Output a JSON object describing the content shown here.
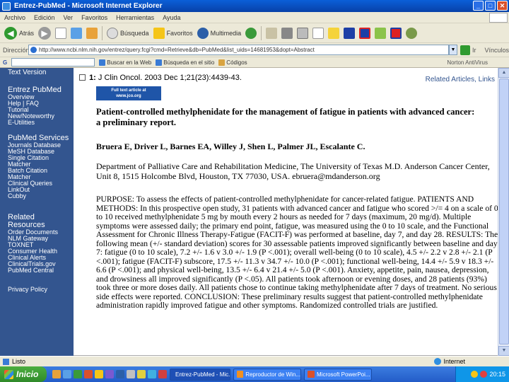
{
  "window": {
    "title": "Entrez-PubMed - Microsoft Internet Explorer",
    "minimize": "_",
    "maximize": "□",
    "close": "✕"
  },
  "menu": [
    "Archivo",
    "Edición",
    "Ver",
    "Favoritos",
    "Herramientas",
    "Ayuda"
  ],
  "toolbar": {
    "back_label": "Atrás",
    "search_label": "Búsqueda",
    "favorites_label": "Favoritos",
    "multimedia_label": "Multimedia"
  },
  "address": {
    "label": "Dirección",
    "url": "http://www.ncbi.nlm.nih.gov/entrez/query.fcgi?cmd=Retrieve&db=PubMed&list_uids=14681953&dopt=Abstract",
    "go_label": "Ir",
    "links_label": "Vínculos"
  },
  "google_bar": {
    "search_web": "Buscar en la Web",
    "search_site": "Búsqueda en el sitio",
    "codes": "Códigos",
    "norton": "Norton AntiVirus"
  },
  "sidebar": {
    "top_link": "Text Version",
    "sections": [
      {
        "heading": "Entrez PubMed",
        "links": [
          "Overview",
          "Help | FAQ",
          "Tutorial",
          "New/Noteworthy",
          "E-Utilities"
        ]
      },
      {
        "heading": "PubMed Services",
        "links": [
          "Journals Database",
          "MeSH Database",
          "Single Citation",
          "Matcher",
          "Batch Citation",
          "Matcher",
          "Clinical Queries",
          "LinkOut",
          "Cubby"
        ]
      },
      {
        "heading": "Related Resources",
        "links": [
          "Order Documents",
          "NLM Gateway",
          "TOXNET",
          "Consumer Health",
          "Clinical Alerts",
          "ClinicalTrials.gov",
          "PubMed Central"
        ]
      }
    ],
    "privacy": "Privacy Policy"
  },
  "article": {
    "citation_number": "1:",
    "citation": "J Clin Oncol. 2003 Dec 1;21(23):4439-43.",
    "related_links": "Related Articles, Links",
    "fulltext_banner": "Full text article at www.jco.org",
    "title": "Patient-controlled methylphenidate for the management of fatigue in patients with advanced cancer: a preliminary report.",
    "authors": "Bruera E, Driver L, Barnes EA, Willey J, Shen L, Palmer JL, Escalante C.",
    "affiliation": "Department of Palliative Care and Rehabilitation Medicine, The University of Texas M.D. Anderson Cancer Center, Unit 8, 1515 Holcombe Blvd, Houston, TX 77030, USA. ebruera@mdanderson.org",
    "abstract": "PURPOSE: To assess the effects of patient-controlled methylphenidate for cancer-related fatigue. PATIENTS AND METHODS: In this prospective open study, 31 patients with advanced cancer and fatigue who scored >/= 4 on a scale of 0 to 10 received methylphenidate 5 mg by mouth every 2 hours as needed for 7 days (maximum, 20 mg/d). Multiple symptoms were assessed daily; the primary end point, fatigue, was measured using the 0 to 10 scale, and the Functional Assessment for Chronic Illness Therapy-Fatigue (FACIT-F) was performed at baseline, day 7, and day 28. RESULTS: The following mean (+/- standard deviation) scores for 30 assessable patients improved significantly between baseline and day 7: fatigue (0 to 10 scale), 7.2 +/- 1.6 v 3.0 +/- 1.9 (P <.001); overall well-being (0 to 10 scale), 4.5 +/- 2.2 v 2.8 +/- 2.1 (P <.001); fatigue (FACIT-F) subscore, 17.5 +/- 11.3 v 34.7 +/- 10.0 (P <.001); functional well-being, 14.4 +/- 5.9 v 18.3 +/- 6.6 (P <.001); and physical well-being, 13.5 +/- 6.4 v 21.4 +/- 5.0 (P <.001). Anxiety, appetite, pain, nausea, depression, and drowsiness all improved significantly (P <.05). All patients took afternoon or evening doses, and 28 patients (93%) took three or more doses daily. All patients chose to continue taking methylphenidate after 7 days of treatment. No serious side effects were reported. CONCLUSION: These preliminary results suggest that patient-controlled methylphenidate administration rapidly improved fatigue and other symptoms. Randomized controlled trials are justified."
  },
  "status": {
    "text": "Listo",
    "zone": "Internet"
  },
  "taskbar": {
    "start_label": "Inicio",
    "tasks": [
      "Entrez-PubMed - Mic...",
      "Reproductor de Win...",
      "Microsoft PowerPoi..."
    ],
    "clock": "20:15"
  }
}
